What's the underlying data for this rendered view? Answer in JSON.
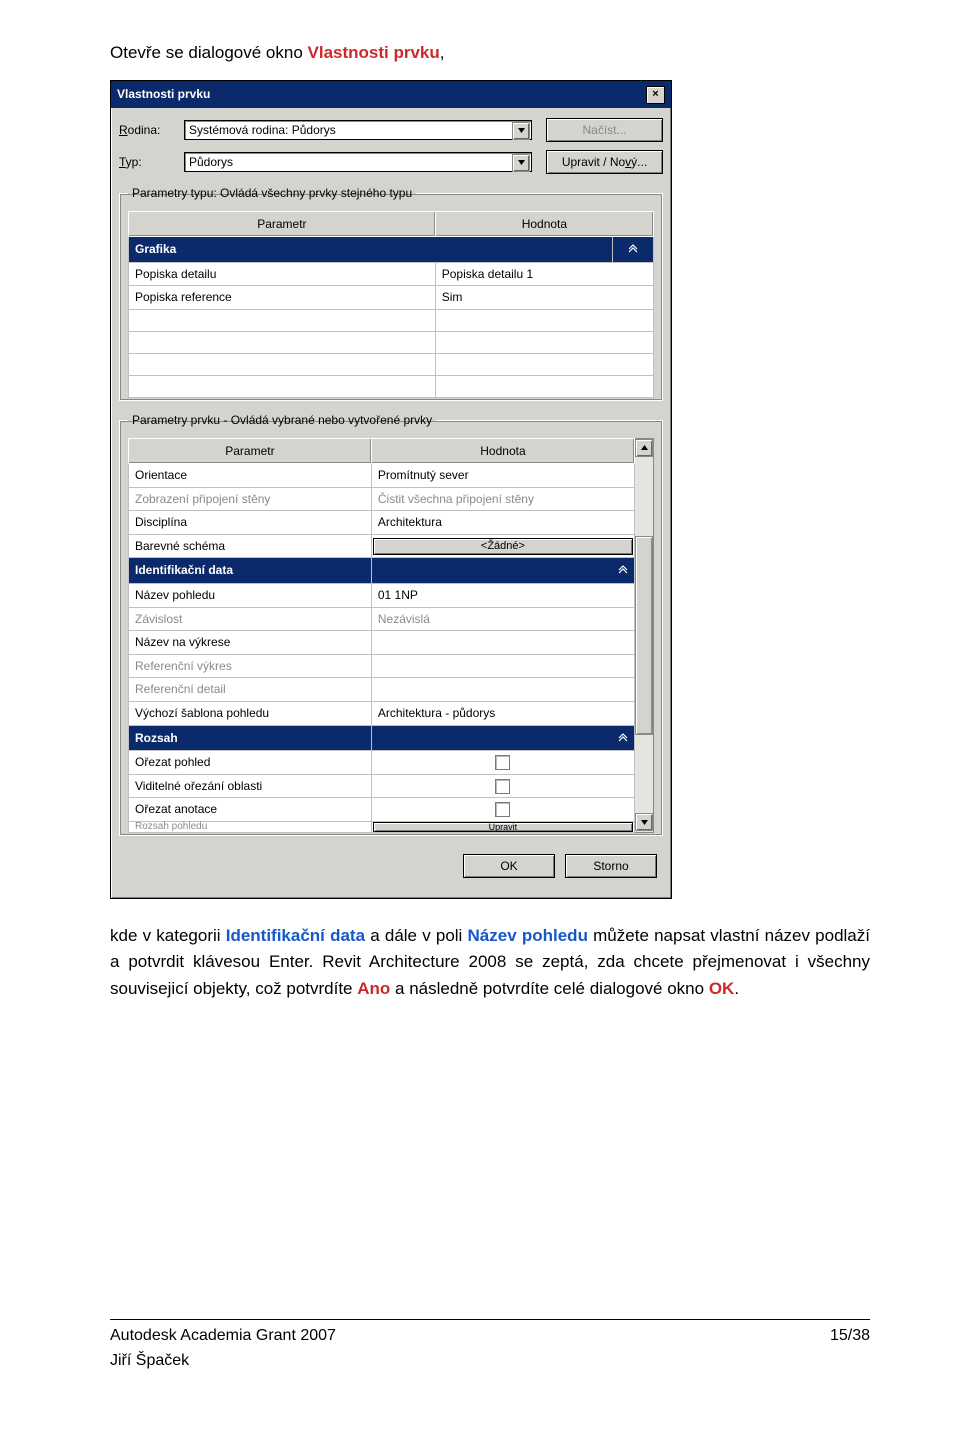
{
  "intro": {
    "prefix": "Otevře se dialogové okno ",
    "dlgname": "Vlastnosti prvku",
    "suffix": ","
  },
  "dialog": {
    "title": "Vlastnosti prvku",
    "close": "×",
    "fields": {
      "rodina_label_u": "R",
      "rodina_label_rest": "odina:",
      "rodina_value": "Systémová rodina: Půdorys",
      "typ_label_u": "T",
      "typ_label_rest": "yp:",
      "typ_value": "Půdorys",
      "nacist_label": "Načíst...",
      "upravit_prefix": "Upravit / No",
      "upravit_u": "v",
      "upravit_suffix": "ý..."
    },
    "fs1": {
      "legend": "Parametry typu: Ovládá všechny prvky stejného typu",
      "hdr_param": "Parametr",
      "hdr_val": "Hodnota",
      "section": "Grafika",
      "rows": [
        {
          "p": "Popiska detailu",
          "v": "Popiska detailu 1"
        },
        {
          "p": "Popiska reference",
          "v": "Sim"
        }
      ]
    },
    "fs2": {
      "legend": "Parametry prvku - Ovládá vybrané nebo vytvořené prvky",
      "hdr_param": "Parametr",
      "hdr_val": "Hodnota",
      "rows1": [
        {
          "p": "Orientace",
          "v": "Promítnutý sever",
          "grey": false
        },
        {
          "p": "Zobrazení připojení stěny",
          "v": "Čistit všechna připojení stěny",
          "grey": true
        },
        {
          "p": "Disciplína",
          "v": "Architektura",
          "grey": false
        }
      ],
      "barevne_p": "Barevné schéma",
      "barevne_btn": "<Žádné>",
      "identsection": "Identifikační data",
      "rows2": [
        {
          "p": "Název pohledu",
          "v": "01 1NP",
          "grey": false
        },
        {
          "p": "Závislost",
          "v": "Nezávislá",
          "grey": true
        },
        {
          "p": "Název na výkrese",
          "v": "",
          "grey": false
        },
        {
          "p": "Referenční výkres",
          "v": "",
          "grey": true
        },
        {
          "p": "Referenční detail",
          "v": "",
          "grey": true
        },
        {
          "p": "Výchozí šablona pohledu",
          "v": "Architektura - půdorys",
          "grey": false
        }
      ],
      "rozsah_section": "Rozsah",
      "rows3": [
        {
          "p": "Ořezat pohled",
          "cb": true
        },
        {
          "p": "Viditelné ořezání oblasti",
          "cb": true
        },
        {
          "p": "Ořezat anotace",
          "cb": true
        }
      ],
      "rowcut_p": "Rozsah pohledu",
      "rowcut_btn": "Upravit"
    },
    "ok": "OK",
    "storno": "Storno"
  },
  "para2": {
    "t1": "kde v kategorii ",
    "ident": "Identifikační data",
    "t2": " a dále v poli ",
    "nazev": "Název pohledu",
    "t3_end": " můžete napsat vlastní název podlaží a potvrdit klávesou Enter. Revit Architecture 2008 se zeptá, zda chcete přejmenovat i všechny souvisejicí objekty, což potvrdíte ",
    "ano": "Ano",
    "t4": " a následně potvrdíte celé dialogové okno ",
    "ok": "OK",
    "dot": "."
  },
  "footer": {
    "left1": "Autodesk Academia Grant 2007",
    "left2": "Jiří Špaček",
    "right": "15/38"
  }
}
